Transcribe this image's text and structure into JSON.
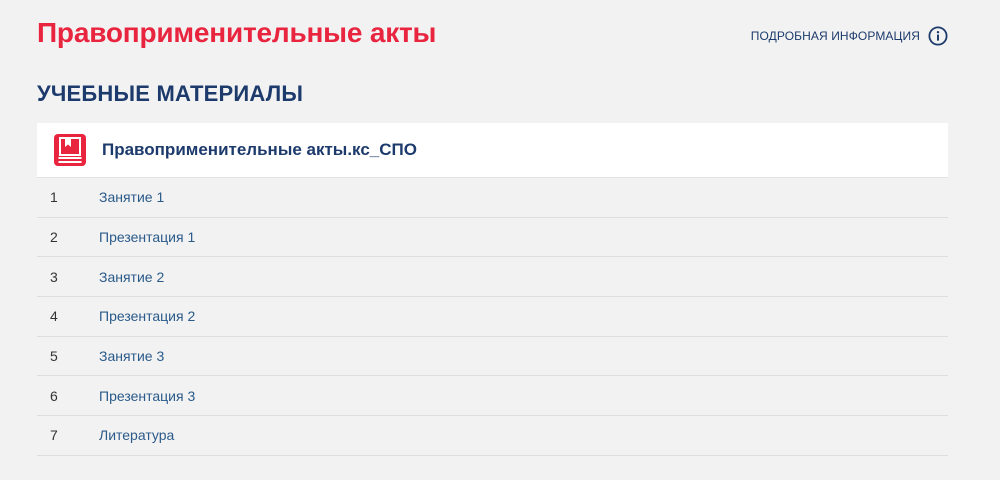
{
  "header": {
    "title": "Правоприменительные акты",
    "info_link_label": "ПОДРОБНАЯ ИНФОРМАЦИЯ",
    "info_icon": "info-circle-icon"
  },
  "section": {
    "title": "УЧЕБНЫЕ МАТЕРИАЛЫ"
  },
  "course": {
    "icon": "book-icon",
    "name": "Правоприменительные акты.кс_СПО"
  },
  "materials": [
    {
      "num": "1",
      "label": "Занятие 1"
    },
    {
      "num": "2",
      "label": "Презентация 1"
    },
    {
      "num": "3",
      "label": "Занятие 2"
    },
    {
      "num": "4",
      "label": "Презентация 2"
    },
    {
      "num": "5",
      "label": "Занятие 3"
    },
    {
      "num": "6",
      "label": "Презентация 3"
    },
    {
      "num": "7",
      "label": "Литература"
    }
  ],
  "colors": {
    "title_red": "#e8243f",
    "navy": "#1c3a6b",
    "link_blue": "#2a5a8a",
    "background": "#f2f2f2"
  }
}
